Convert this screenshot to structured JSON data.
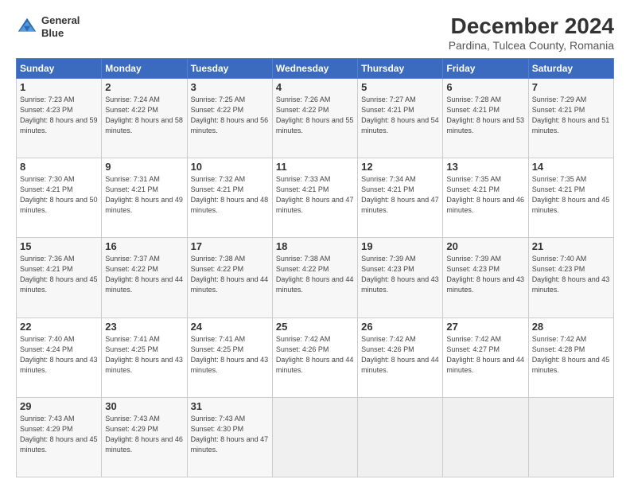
{
  "header": {
    "logo_line1": "General",
    "logo_line2": "Blue",
    "title": "December 2024",
    "subtitle": "Pardina, Tulcea County, Romania"
  },
  "weekdays": [
    "Sunday",
    "Monday",
    "Tuesday",
    "Wednesday",
    "Thursday",
    "Friday",
    "Saturday"
  ],
  "weeks": [
    [
      {
        "day": "1",
        "sunrise": "7:23 AM",
        "sunset": "4:23 PM",
        "daylight": "8 hours and 59 minutes."
      },
      {
        "day": "2",
        "sunrise": "7:24 AM",
        "sunset": "4:22 PM",
        "daylight": "8 hours and 58 minutes."
      },
      {
        "day": "3",
        "sunrise": "7:25 AM",
        "sunset": "4:22 PM",
        "daylight": "8 hours and 56 minutes."
      },
      {
        "day": "4",
        "sunrise": "7:26 AM",
        "sunset": "4:22 PM",
        "daylight": "8 hours and 55 minutes."
      },
      {
        "day": "5",
        "sunrise": "7:27 AM",
        "sunset": "4:21 PM",
        "daylight": "8 hours and 54 minutes."
      },
      {
        "day": "6",
        "sunrise": "7:28 AM",
        "sunset": "4:21 PM",
        "daylight": "8 hours and 53 minutes."
      },
      {
        "day": "7",
        "sunrise": "7:29 AM",
        "sunset": "4:21 PM",
        "daylight": "8 hours and 51 minutes."
      }
    ],
    [
      {
        "day": "8",
        "sunrise": "7:30 AM",
        "sunset": "4:21 PM",
        "daylight": "8 hours and 50 minutes."
      },
      {
        "day": "9",
        "sunrise": "7:31 AM",
        "sunset": "4:21 PM",
        "daylight": "8 hours and 49 minutes."
      },
      {
        "day": "10",
        "sunrise": "7:32 AM",
        "sunset": "4:21 PM",
        "daylight": "8 hours and 48 minutes."
      },
      {
        "day": "11",
        "sunrise": "7:33 AM",
        "sunset": "4:21 PM",
        "daylight": "8 hours and 47 minutes."
      },
      {
        "day": "12",
        "sunrise": "7:34 AM",
        "sunset": "4:21 PM",
        "daylight": "8 hours and 47 minutes."
      },
      {
        "day": "13",
        "sunrise": "7:35 AM",
        "sunset": "4:21 PM",
        "daylight": "8 hours and 46 minutes."
      },
      {
        "day": "14",
        "sunrise": "7:35 AM",
        "sunset": "4:21 PM",
        "daylight": "8 hours and 45 minutes."
      }
    ],
    [
      {
        "day": "15",
        "sunrise": "7:36 AM",
        "sunset": "4:21 PM",
        "daylight": "8 hours and 45 minutes."
      },
      {
        "day": "16",
        "sunrise": "7:37 AM",
        "sunset": "4:22 PM",
        "daylight": "8 hours and 44 minutes."
      },
      {
        "day": "17",
        "sunrise": "7:38 AM",
        "sunset": "4:22 PM",
        "daylight": "8 hours and 44 minutes."
      },
      {
        "day": "18",
        "sunrise": "7:38 AM",
        "sunset": "4:22 PM",
        "daylight": "8 hours and 44 minutes."
      },
      {
        "day": "19",
        "sunrise": "7:39 AM",
        "sunset": "4:23 PM",
        "daylight": "8 hours and 43 minutes."
      },
      {
        "day": "20",
        "sunrise": "7:39 AM",
        "sunset": "4:23 PM",
        "daylight": "8 hours and 43 minutes."
      },
      {
        "day": "21",
        "sunrise": "7:40 AM",
        "sunset": "4:23 PM",
        "daylight": "8 hours and 43 minutes."
      }
    ],
    [
      {
        "day": "22",
        "sunrise": "7:40 AM",
        "sunset": "4:24 PM",
        "daylight": "8 hours and 43 minutes."
      },
      {
        "day": "23",
        "sunrise": "7:41 AM",
        "sunset": "4:25 PM",
        "daylight": "8 hours and 43 minutes."
      },
      {
        "day": "24",
        "sunrise": "7:41 AM",
        "sunset": "4:25 PM",
        "daylight": "8 hours and 43 minutes."
      },
      {
        "day": "25",
        "sunrise": "7:42 AM",
        "sunset": "4:26 PM",
        "daylight": "8 hours and 44 minutes."
      },
      {
        "day": "26",
        "sunrise": "7:42 AM",
        "sunset": "4:26 PM",
        "daylight": "8 hours and 44 minutes."
      },
      {
        "day": "27",
        "sunrise": "7:42 AM",
        "sunset": "4:27 PM",
        "daylight": "8 hours and 44 minutes."
      },
      {
        "day": "28",
        "sunrise": "7:42 AM",
        "sunset": "4:28 PM",
        "daylight": "8 hours and 45 minutes."
      }
    ],
    [
      {
        "day": "29",
        "sunrise": "7:43 AM",
        "sunset": "4:29 PM",
        "daylight": "8 hours and 45 minutes."
      },
      {
        "day": "30",
        "sunrise": "7:43 AM",
        "sunset": "4:29 PM",
        "daylight": "8 hours and 46 minutes."
      },
      {
        "day": "31",
        "sunrise": "7:43 AM",
        "sunset": "4:30 PM",
        "daylight": "8 hours and 47 minutes."
      },
      null,
      null,
      null,
      null
    ]
  ]
}
